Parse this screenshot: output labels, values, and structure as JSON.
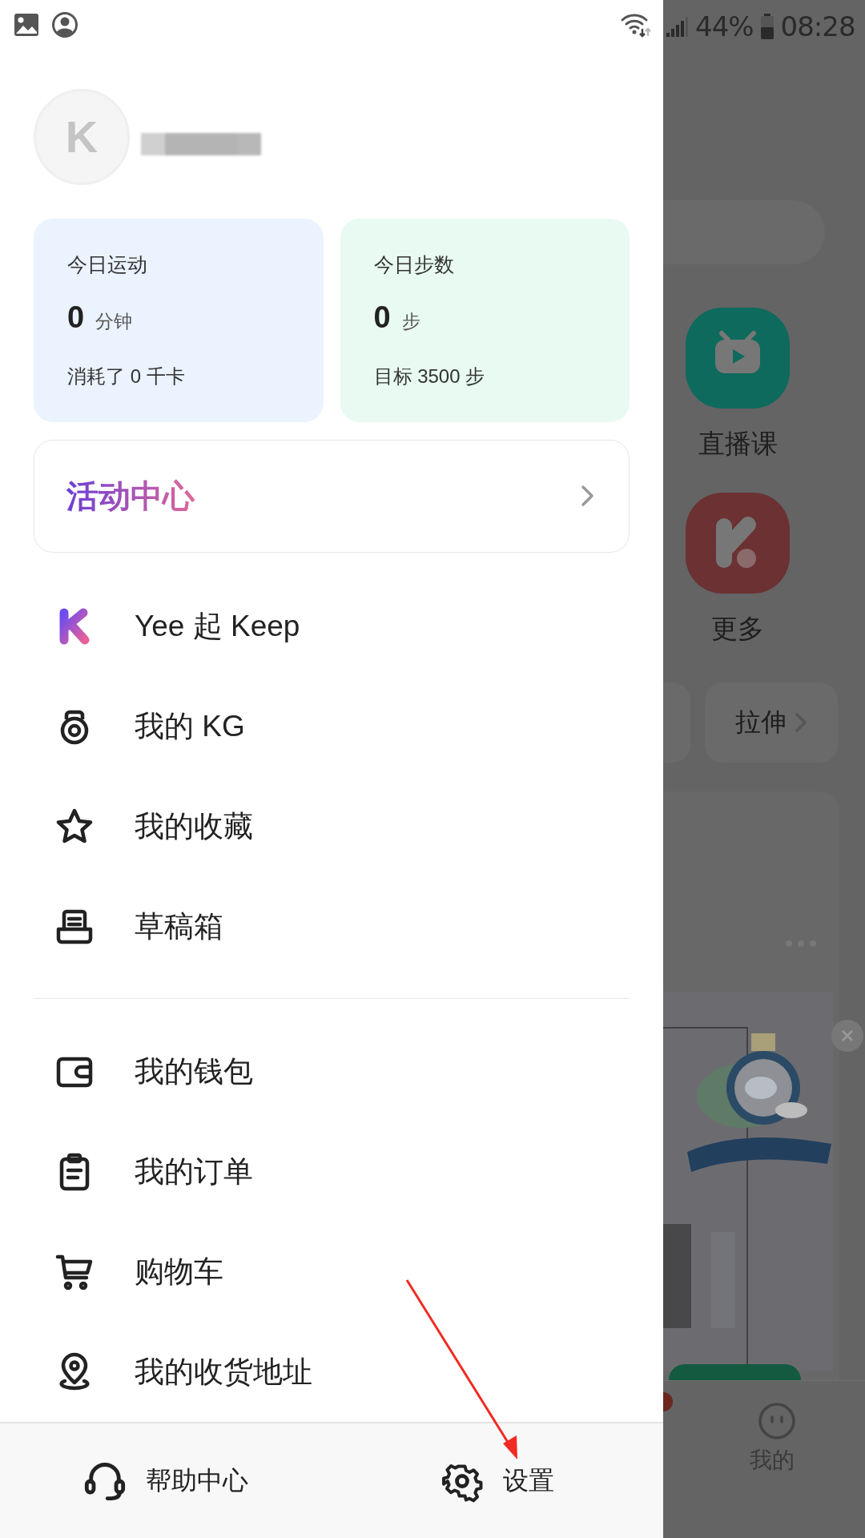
{
  "status_bar": {
    "battery_percent": "44%",
    "time": "08:28"
  },
  "profile": {
    "avatar_letter": "K"
  },
  "stats": [
    {
      "title": "今日运动",
      "value": "0",
      "unit": "分钟",
      "detail": "消耗了 0 千卡",
      "color": "#eaf3fe"
    },
    {
      "title": "今日步数",
      "value": "0",
      "unit": "步",
      "detail": "目标 3500 步",
      "color": "#e8faf1"
    }
  ],
  "activity_card": {
    "title": "活动中心"
  },
  "menu_sections": [
    {
      "items": [
        {
          "label": "Yee 起 Keep"
        },
        {
          "label": "我的 KG"
        },
        {
          "label": "我的收藏"
        },
        {
          "label": "草稿箱"
        }
      ]
    },
    {
      "items": [
        {
          "label": "我的钱包"
        },
        {
          "label": "我的订单"
        },
        {
          "label": "购物车"
        },
        {
          "label": "我的收货地址"
        }
      ]
    }
  ],
  "bottom_bar": [
    {
      "label": "帮助中心"
    },
    {
      "label": "设置"
    }
  ],
  "background_app": {
    "shortcuts": [
      {
        "label": "直播课",
        "color": "#0e6a5d"
      },
      {
        "label": "更多",
        "color": "#6c3133"
      }
    ],
    "chips": [
      "拉伸"
    ],
    "nav_label": "我的"
  }
}
